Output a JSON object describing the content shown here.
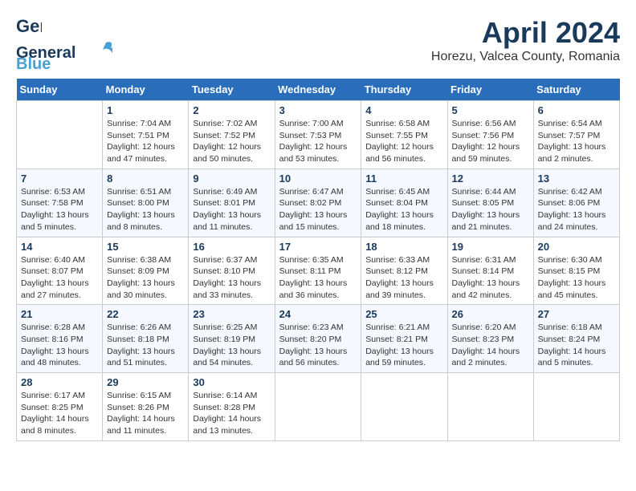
{
  "header": {
    "logo_general": "General",
    "logo_blue": "Blue",
    "month_year": "April 2024",
    "location": "Horezu, Valcea County, Romania"
  },
  "weekdays": [
    "Sunday",
    "Monday",
    "Tuesday",
    "Wednesday",
    "Thursday",
    "Friday",
    "Saturday"
  ],
  "weeks": [
    [
      {
        "day": "",
        "empty": true
      },
      {
        "day": "1",
        "sunrise": "Sunrise: 7:04 AM",
        "sunset": "Sunset: 7:51 PM",
        "daylight": "Daylight: 12 hours and 47 minutes."
      },
      {
        "day": "2",
        "sunrise": "Sunrise: 7:02 AM",
        "sunset": "Sunset: 7:52 PM",
        "daylight": "Daylight: 12 hours and 50 minutes."
      },
      {
        "day": "3",
        "sunrise": "Sunrise: 7:00 AM",
        "sunset": "Sunset: 7:53 PM",
        "daylight": "Daylight: 12 hours and 53 minutes."
      },
      {
        "day": "4",
        "sunrise": "Sunrise: 6:58 AM",
        "sunset": "Sunset: 7:55 PM",
        "daylight": "Daylight: 12 hours and 56 minutes."
      },
      {
        "day": "5",
        "sunrise": "Sunrise: 6:56 AM",
        "sunset": "Sunset: 7:56 PM",
        "daylight": "Daylight: 12 hours and 59 minutes."
      },
      {
        "day": "6",
        "sunrise": "Sunrise: 6:54 AM",
        "sunset": "Sunset: 7:57 PM",
        "daylight": "Daylight: 13 hours and 2 minutes."
      }
    ],
    [
      {
        "day": "7",
        "sunrise": "Sunrise: 6:53 AM",
        "sunset": "Sunset: 7:58 PM",
        "daylight": "Daylight: 13 hours and 5 minutes."
      },
      {
        "day": "8",
        "sunrise": "Sunrise: 6:51 AM",
        "sunset": "Sunset: 8:00 PM",
        "daylight": "Daylight: 13 hours and 8 minutes."
      },
      {
        "day": "9",
        "sunrise": "Sunrise: 6:49 AM",
        "sunset": "Sunset: 8:01 PM",
        "daylight": "Daylight: 13 hours and 11 minutes."
      },
      {
        "day": "10",
        "sunrise": "Sunrise: 6:47 AM",
        "sunset": "Sunset: 8:02 PM",
        "daylight": "Daylight: 13 hours and 15 minutes."
      },
      {
        "day": "11",
        "sunrise": "Sunrise: 6:45 AM",
        "sunset": "Sunset: 8:04 PM",
        "daylight": "Daylight: 13 hours and 18 minutes."
      },
      {
        "day": "12",
        "sunrise": "Sunrise: 6:44 AM",
        "sunset": "Sunset: 8:05 PM",
        "daylight": "Daylight: 13 hours and 21 minutes."
      },
      {
        "day": "13",
        "sunrise": "Sunrise: 6:42 AM",
        "sunset": "Sunset: 8:06 PM",
        "daylight": "Daylight: 13 hours and 24 minutes."
      }
    ],
    [
      {
        "day": "14",
        "sunrise": "Sunrise: 6:40 AM",
        "sunset": "Sunset: 8:07 PM",
        "daylight": "Daylight: 13 hours and 27 minutes."
      },
      {
        "day": "15",
        "sunrise": "Sunrise: 6:38 AM",
        "sunset": "Sunset: 8:09 PM",
        "daylight": "Daylight: 13 hours and 30 minutes."
      },
      {
        "day": "16",
        "sunrise": "Sunrise: 6:37 AM",
        "sunset": "Sunset: 8:10 PM",
        "daylight": "Daylight: 13 hours and 33 minutes."
      },
      {
        "day": "17",
        "sunrise": "Sunrise: 6:35 AM",
        "sunset": "Sunset: 8:11 PM",
        "daylight": "Daylight: 13 hours and 36 minutes."
      },
      {
        "day": "18",
        "sunrise": "Sunrise: 6:33 AM",
        "sunset": "Sunset: 8:12 PM",
        "daylight": "Daylight: 13 hours and 39 minutes."
      },
      {
        "day": "19",
        "sunrise": "Sunrise: 6:31 AM",
        "sunset": "Sunset: 8:14 PM",
        "daylight": "Daylight: 13 hours and 42 minutes."
      },
      {
        "day": "20",
        "sunrise": "Sunrise: 6:30 AM",
        "sunset": "Sunset: 8:15 PM",
        "daylight": "Daylight: 13 hours and 45 minutes."
      }
    ],
    [
      {
        "day": "21",
        "sunrise": "Sunrise: 6:28 AM",
        "sunset": "Sunset: 8:16 PM",
        "daylight": "Daylight: 13 hours and 48 minutes."
      },
      {
        "day": "22",
        "sunrise": "Sunrise: 6:26 AM",
        "sunset": "Sunset: 8:18 PM",
        "daylight": "Daylight: 13 hours and 51 minutes."
      },
      {
        "day": "23",
        "sunrise": "Sunrise: 6:25 AM",
        "sunset": "Sunset: 8:19 PM",
        "daylight": "Daylight: 13 hours and 54 minutes."
      },
      {
        "day": "24",
        "sunrise": "Sunrise: 6:23 AM",
        "sunset": "Sunset: 8:20 PM",
        "daylight": "Daylight: 13 hours and 56 minutes."
      },
      {
        "day": "25",
        "sunrise": "Sunrise: 6:21 AM",
        "sunset": "Sunset: 8:21 PM",
        "daylight": "Daylight: 13 hours and 59 minutes."
      },
      {
        "day": "26",
        "sunrise": "Sunrise: 6:20 AM",
        "sunset": "Sunset: 8:23 PM",
        "daylight": "Daylight: 14 hours and 2 minutes."
      },
      {
        "day": "27",
        "sunrise": "Sunrise: 6:18 AM",
        "sunset": "Sunset: 8:24 PM",
        "daylight": "Daylight: 14 hours and 5 minutes."
      }
    ],
    [
      {
        "day": "28",
        "sunrise": "Sunrise: 6:17 AM",
        "sunset": "Sunset: 8:25 PM",
        "daylight": "Daylight: 14 hours and 8 minutes."
      },
      {
        "day": "29",
        "sunrise": "Sunrise: 6:15 AM",
        "sunset": "Sunset: 8:26 PM",
        "daylight": "Daylight: 14 hours and 11 minutes."
      },
      {
        "day": "30",
        "sunrise": "Sunrise: 6:14 AM",
        "sunset": "Sunset: 8:28 PM",
        "daylight": "Daylight: 14 hours and 13 minutes."
      },
      {
        "day": "",
        "empty": true
      },
      {
        "day": "",
        "empty": true
      },
      {
        "day": "",
        "empty": true
      },
      {
        "day": "",
        "empty": true
      }
    ]
  ]
}
